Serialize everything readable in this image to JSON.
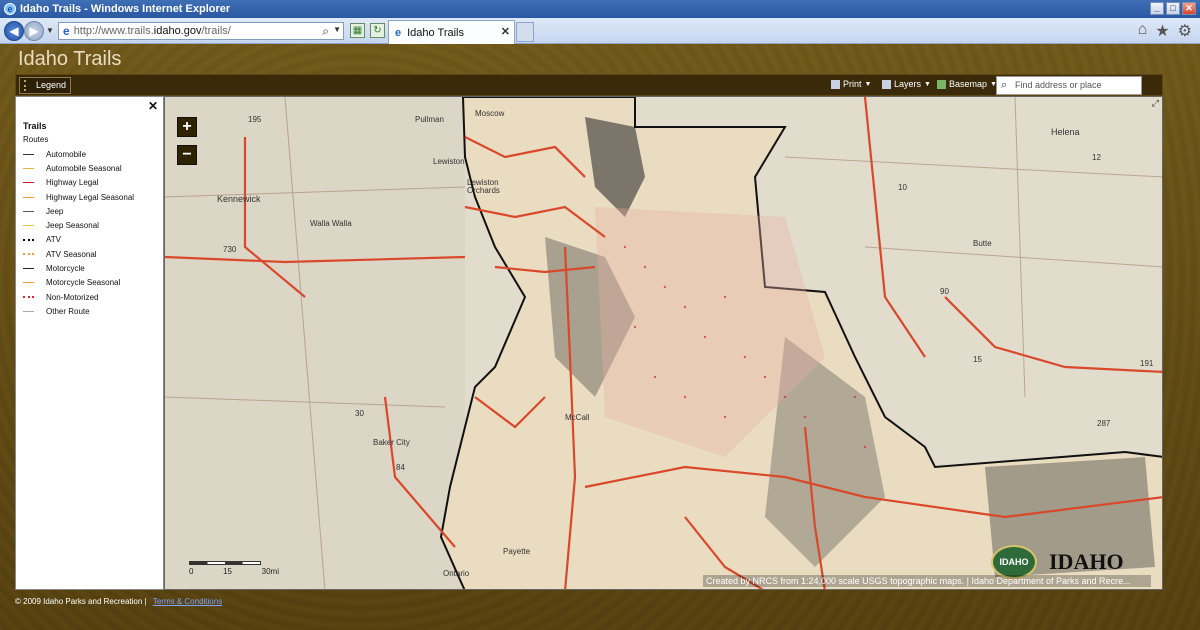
{
  "window": {
    "title": "Idaho Trails - Windows Internet Explorer"
  },
  "browser": {
    "url_prefix": "http://www.trails.",
    "url_host": "idaho.gov",
    "url_path": "/trails/",
    "tab_title": "Idaho Trails",
    "toolbar_icons": [
      "home-icon",
      "star-icon",
      "gear-icon"
    ]
  },
  "app": {
    "title": "Idaho Trails",
    "legend_button": "Legend",
    "print_label": "Print",
    "layers_label": "Layers",
    "basemap_label": "Basemap",
    "search_placeholder": "Find address or place"
  },
  "legend": {
    "heading": "Trails",
    "subheading": "Routes",
    "items": [
      {
        "label": "Automobile",
        "color": "#333333",
        "style": "solid"
      },
      {
        "label": "Automobile Seasonal",
        "color": "#e8b04a",
        "style": "solid"
      },
      {
        "label": "Highway Legal",
        "color": "#cc1f1f",
        "style": "solid"
      },
      {
        "label": "Highway Legal Seasonal",
        "color": "#f0a030",
        "style": "solid"
      },
      {
        "label": "Jeep",
        "color": "#555555",
        "style": "solid"
      },
      {
        "label": "Jeep Seasonal",
        "color": "#e6c35a",
        "style": "solid"
      },
      {
        "label": "ATV",
        "color": "#000000",
        "style": "dotted"
      },
      {
        "label": "ATV Seasonal",
        "color": "#f0a030",
        "style": "dotted"
      },
      {
        "label": "Motorcycle",
        "color": "#222222",
        "style": "solid"
      },
      {
        "label": "Motorcycle Seasonal",
        "color": "#f0a030",
        "style": "solid"
      },
      {
        "label": "Non-Motorized",
        "color": "#d62828",
        "style": "dotted"
      },
      {
        "label": "Other Route",
        "color": "#aaaaaa",
        "style": "solid"
      }
    ]
  },
  "map": {
    "zoom_in": "+",
    "zoom_out": "−",
    "scale": [
      "0",
      "15",
      "30mi"
    ],
    "attribution": "Created by NRCS from 1:24,000 scale USGS topographic maps. | Idaho Department of Parks and Recre...",
    "logo_badge": "IDAHO",
    "logo_text": "IDAHO",
    "places": [
      "Moscow",
      "Pullman",
      "Lewiston",
      "Lewiston Orchards",
      "Kennewick",
      "Walla Walla",
      "Baker City",
      "McCall",
      "Payette",
      "Ontario",
      "Helena",
      "Butte"
    ],
    "highways": [
      "195",
      "12",
      "730",
      "30",
      "84",
      "10",
      "90",
      "15",
      "191",
      "287"
    ]
  },
  "footer": {
    "copyright": "© 2009 Idaho Parks and Recreation  |",
    "terms_link": "Terms & Conditions"
  }
}
